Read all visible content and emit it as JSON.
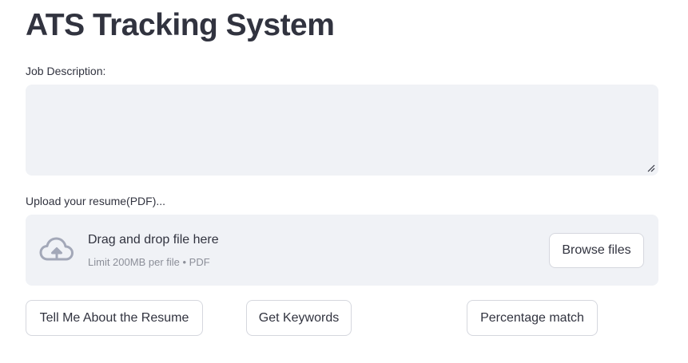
{
  "page": {
    "title": "ATS Tracking System"
  },
  "job_description": {
    "label": "Job Description:",
    "value": "",
    "placeholder": ""
  },
  "upload": {
    "label": "Upload your resume(PDF)...",
    "drop_text": "Drag and drop file here",
    "limit_text": "Limit 200MB per file • PDF",
    "browse_label": "Browse files",
    "icon": "cloud-upload-icon"
  },
  "actions": {
    "about_label": "Tell Me About the Resume",
    "keywords_label": "Get Keywords",
    "match_label": "Percentage match"
  },
  "colors": {
    "text": "#31333f",
    "input_bg": "#f0f2f6",
    "muted_text": "#8c8f99",
    "border": "#d5d7de",
    "icon": "#a3a8b8"
  }
}
